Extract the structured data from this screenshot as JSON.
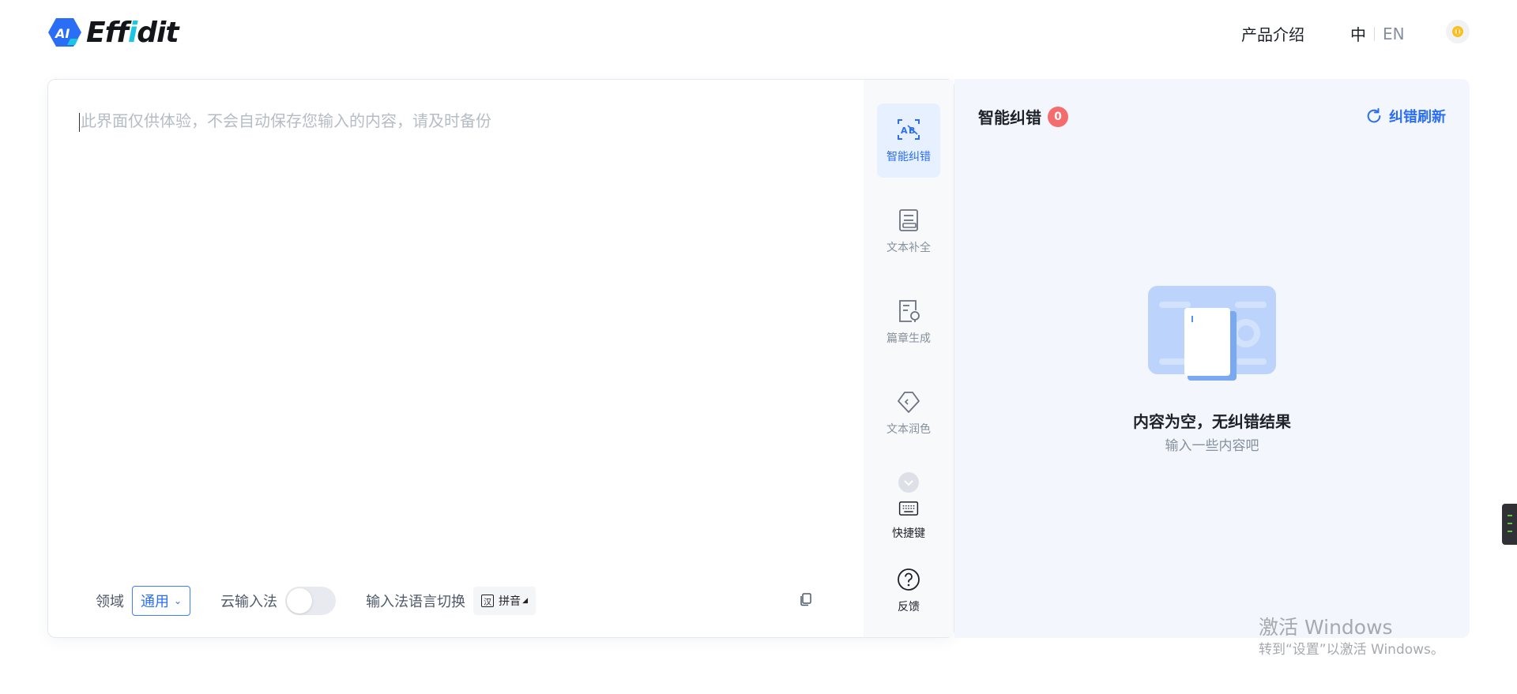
{
  "header": {
    "logo_badge": "AI",
    "logo_text_pre": "Eff",
    "logo_text_i": "i",
    "logo_text_post": "dit",
    "nav_intro": "产品介绍",
    "lang_zh": "中",
    "lang_en": "EN"
  },
  "editor": {
    "placeholder": "此界面仅供体验，不会自动保存您输入的内容，请及时备份",
    "footer": {
      "domain_label": "领域",
      "domain_value": "通用",
      "cloud_ime_label": "云输入法",
      "ime_switch_label": "输入法语言切换",
      "ime_box": "汉",
      "ime_value": "拼音"
    }
  },
  "rail": {
    "tools": [
      {
        "label": "智能纠错",
        "icon": "ai-correct-icon",
        "active": true
      },
      {
        "label": "文本补全",
        "icon": "text-complete-icon"
      },
      {
        "label": "篇章生成",
        "icon": "article-generate-icon"
      },
      {
        "label": "文本润色",
        "icon": "text-polish-icon"
      },
      {
        "label": "快捷键",
        "icon": "keyboard-icon"
      },
      {
        "label": "反馈",
        "icon": "feedback-icon"
      }
    ]
  },
  "panel": {
    "title": "智能纠错",
    "count": "0",
    "refresh_label": "纠错刷新",
    "empty_title": "内容为空，无纠错结果",
    "empty_sub": "输入一些内容吧"
  },
  "watermark": {
    "line1": "激活 Windows",
    "line2": "转到“设置”以激活 Windows。"
  },
  "colors": {
    "accent": "#2b6ef6",
    "badge": "#f56c6c",
    "panel_bg": "#f3f7fd"
  }
}
